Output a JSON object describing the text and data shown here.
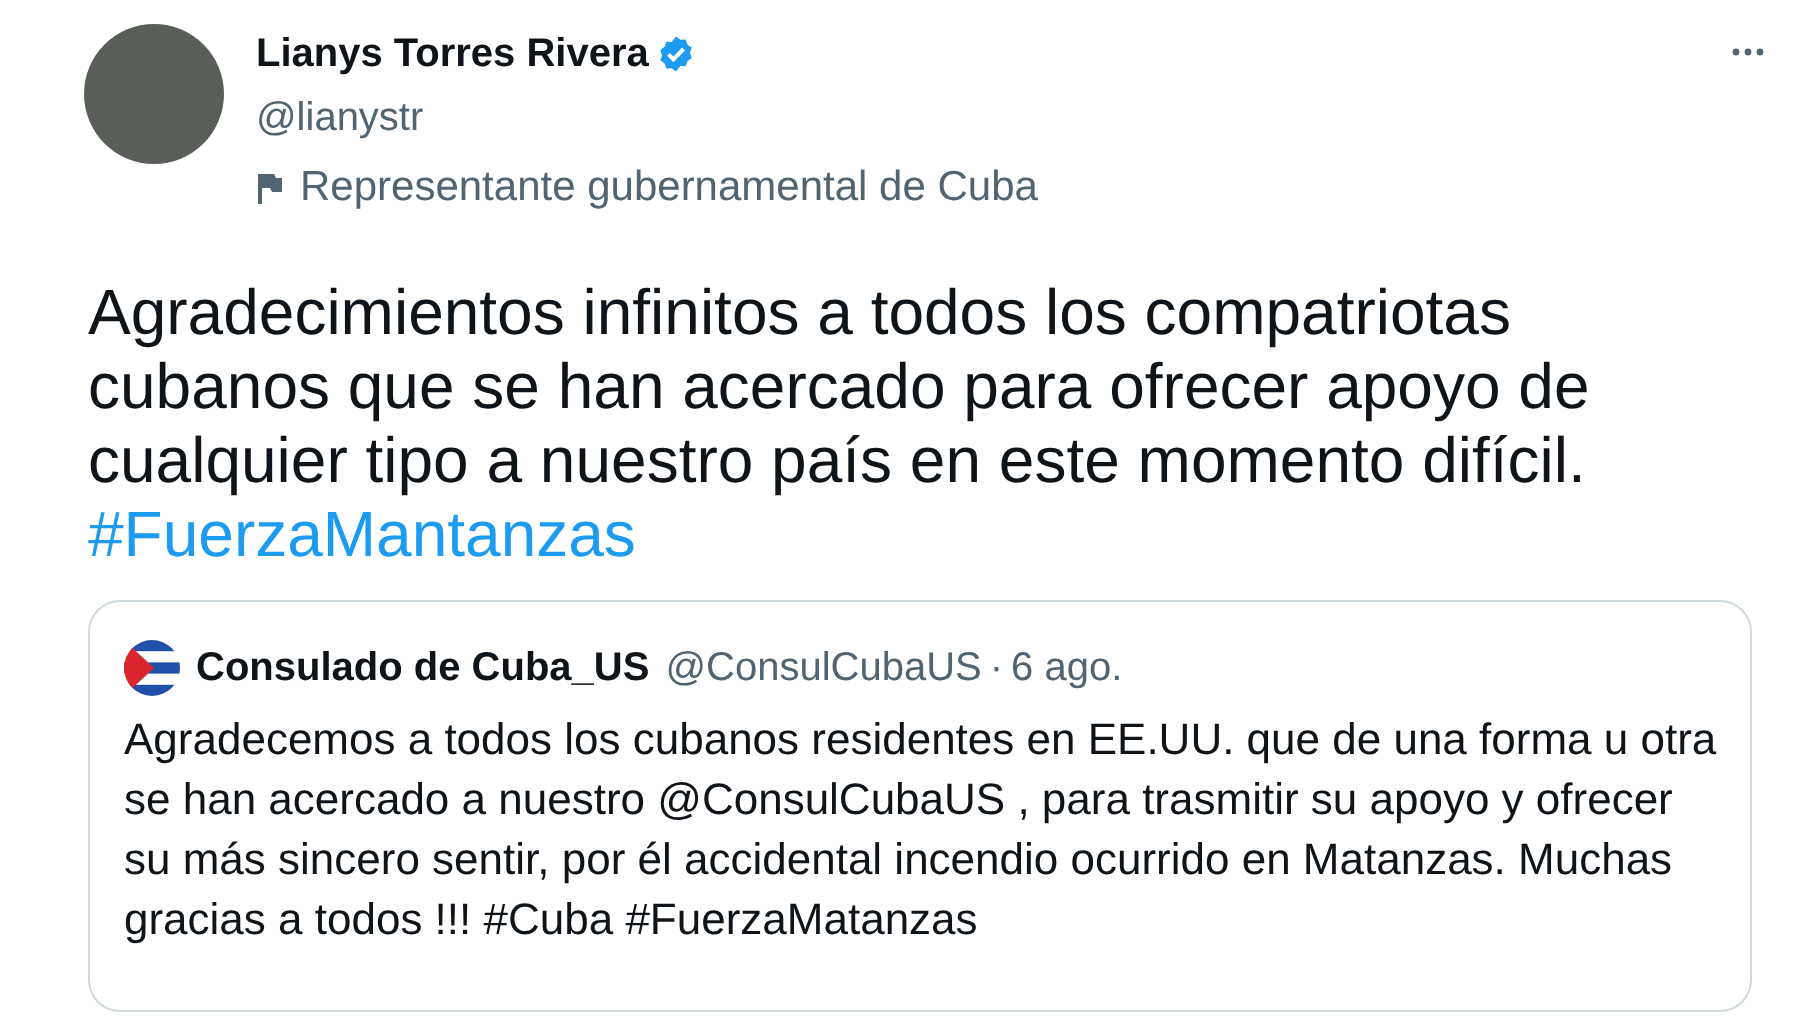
{
  "author": {
    "name": "Lianys Torres Rivera",
    "verified": true,
    "handle": "@lianystr",
    "label": "Representante gubernamental de Cuba"
  },
  "tweet": {
    "text": "Agradecimientos infinitos a todos los compatriotas cubanos que se han acercado para ofrecer apoyo de cualquier tipo a nuestro país en este momento difícil.",
    "hashtag": "#FuerzaMantanzas"
  },
  "quoted_tweet": {
    "name": "Consulado de Cuba_US",
    "handle": "@ConsulCubaUS",
    "separator": "·",
    "date": "6 ago.",
    "text": "Agradecemos a todos los cubanos residentes en EE.UU. que de una forma u otra se han acercado a nuestro @ConsulCubaUS , para trasmitir su apoyo y ofrecer su más sincero sentir, por él accidental incendio ocurrido en Matanzas. Muchas gracias a todos !!! #Cuba #FuerzaMatanzas"
  }
}
